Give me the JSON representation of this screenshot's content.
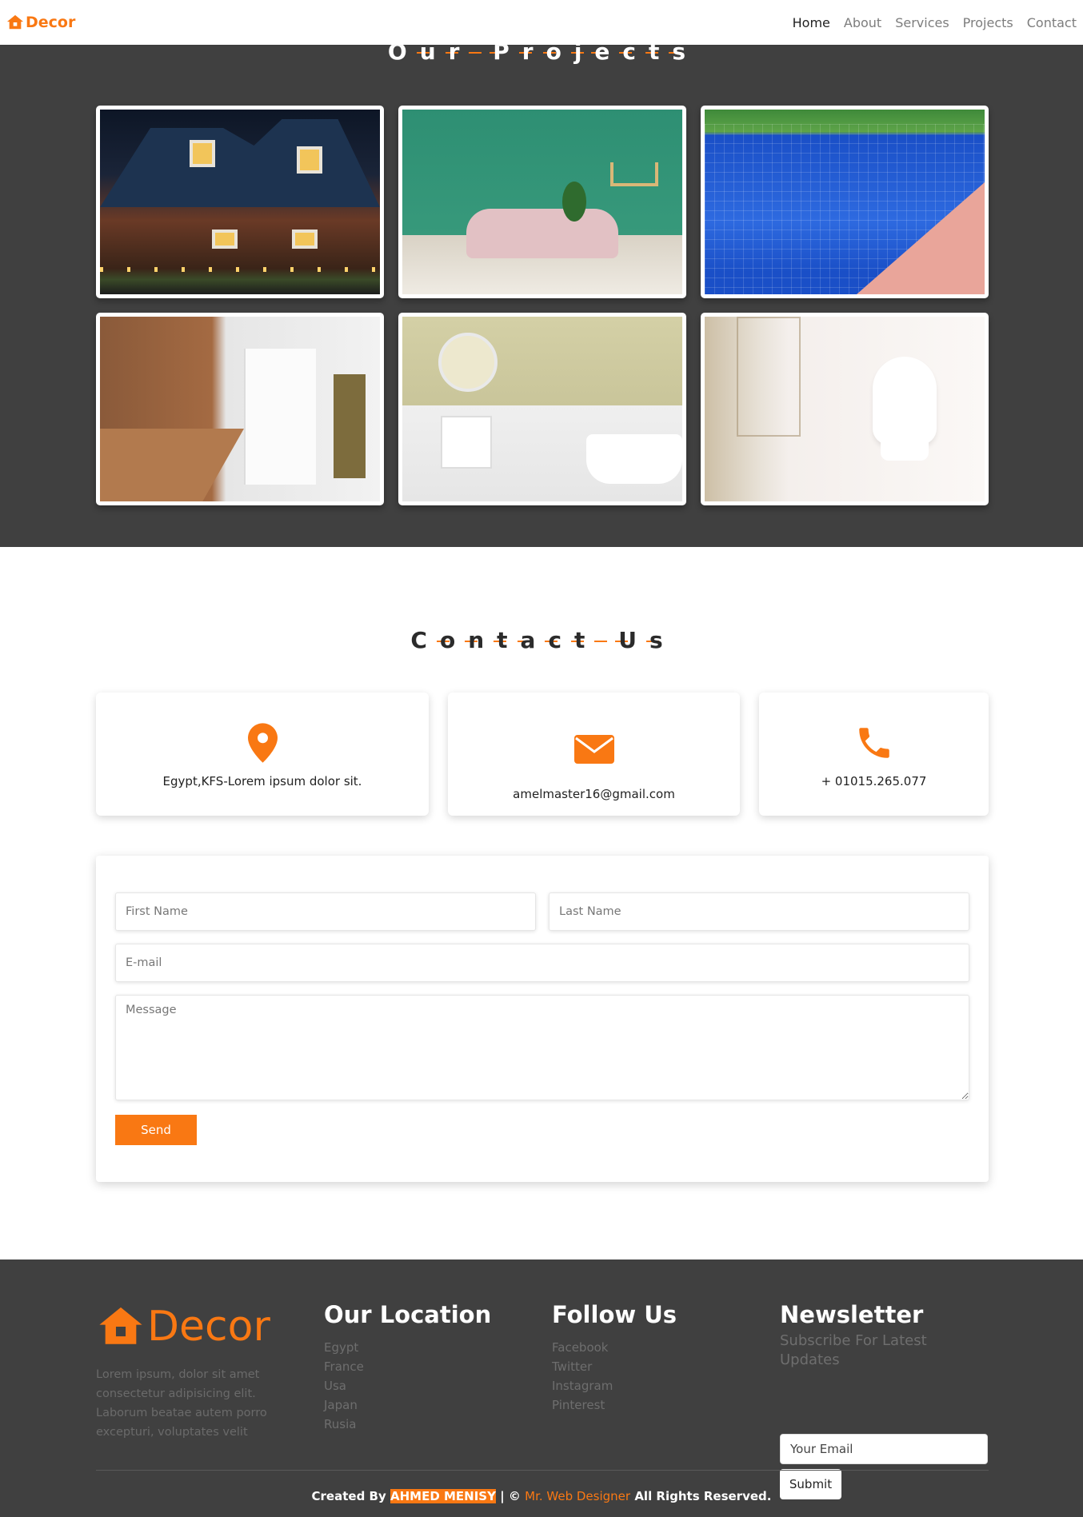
{
  "nav": {
    "brand": "Decor",
    "links": [
      "Home",
      "About",
      "Services",
      "Projects",
      "Contact"
    ],
    "active": "Home"
  },
  "projects": {
    "title": "Our Projects",
    "items": [
      {
        "name": "house"
      },
      {
        "name": "living-room"
      },
      {
        "name": "pool"
      },
      {
        "name": "kitchen"
      },
      {
        "name": "bathroom"
      },
      {
        "name": "toilet"
      }
    ]
  },
  "contact": {
    "title": "Contact Us",
    "address": "Egypt,KFS-Lorem ipsum dolor sit.",
    "email": "amelmaster16@gmail.com",
    "phone": "+ 01015.265.077",
    "form": {
      "first_name_placeholder": "First Name",
      "last_name_placeholder": "Last Name",
      "email_placeholder": "E-mail",
      "message_placeholder": "Message",
      "send_label": "Send"
    }
  },
  "footer": {
    "brand": "Decor",
    "about": "Lorem ipsum, dolor sit amet consectetur adipisicing elit. Laborum beatae autem porro excepturi, voluptates velit",
    "location": {
      "title": "Our Location",
      "items": [
        "Egypt",
        "France",
        "Usa",
        "Japan",
        "Rusia"
      ]
    },
    "follow": {
      "title": "Follow Us",
      "items": [
        "Facebook",
        "Twitter",
        "Instagram",
        "Pinterest"
      ]
    },
    "newsletter": {
      "title": "Newsletter",
      "subtitle": "Subscribe For Latest Updates",
      "input_placeholder": "Your Email",
      "button": "Submit"
    },
    "copyright": {
      "prefix": "Created By",
      "author": "AHMED MENISY",
      "middle": "| ©",
      "designer": "Mr. Web Designer",
      "suffix": "All Rights Reserved."
    }
  },
  "colors": {
    "accent": "#f97813",
    "dark": "#404040"
  },
  "icons": [
    "house-icon",
    "location-pin-icon",
    "envelope-icon",
    "phone-icon"
  ]
}
